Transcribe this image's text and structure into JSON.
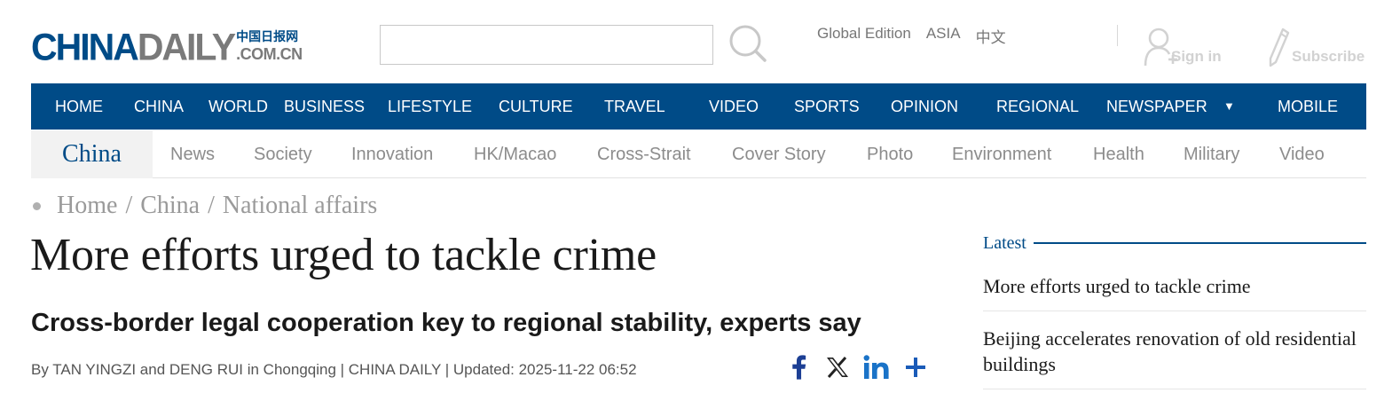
{
  "header": {
    "logo": {
      "main": "CHINA",
      "secondary": "DAILY",
      "cn": "中国日报网",
      "domain": ".COM.CN"
    },
    "search": {
      "value": "",
      "placeholder": ""
    },
    "editions": [
      "Global Edition",
      "ASIA",
      "中文"
    ],
    "signin_label": "Sign in",
    "subscribe_label": "Subscribe"
  },
  "nav": {
    "items": [
      "HOME",
      "CHINA",
      "WORLD",
      "BUSINESS",
      "LIFESTYLE",
      "CULTURE",
      "TRAVEL",
      "VIDEO",
      "SPORTS",
      "OPINION",
      "REGIONAL",
      "NEWSPAPER",
      "MOBILE"
    ]
  },
  "subnav": {
    "title": "China",
    "items": [
      "News",
      "Society",
      "Innovation",
      "HK/Macao",
      "Cross-Strait",
      "Cover Story",
      "Photo",
      "Environment",
      "Health",
      "Military",
      "Video"
    ]
  },
  "article": {
    "breadcrumb": [
      "Home",
      "China",
      "National affairs"
    ],
    "headline": "More efforts urged to tackle crime",
    "subheadline": "Cross-border legal cooperation key to regional stability, experts say",
    "byline": "By TAN YINGZI and DENG RUI in Chongqing | CHINA DAILY | Updated: 2025-11-22 06:52",
    "share_icons": [
      "facebook-icon",
      "x-icon",
      "linkedin-icon",
      "plus-icon"
    ]
  },
  "sidebar": {
    "latest_label": "Latest",
    "items": [
      "More efforts urged to tackle crime",
      "Beijing accelerates renovation of old residential buildings"
    ]
  },
  "colors": {
    "brand_blue": "#004b87",
    "logo_gray": "#7a7a7a",
    "subnav_text": "#8c8c8c",
    "facebook": "#1c3f94",
    "linkedin": "#1a73c8",
    "plus": "#1a5bb8"
  }
}
